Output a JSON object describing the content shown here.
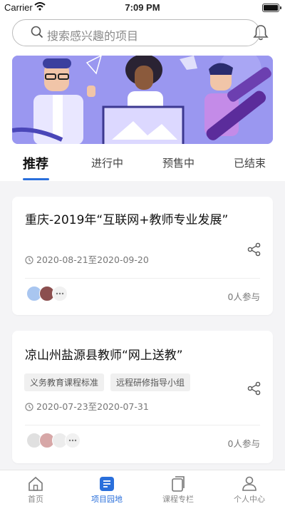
{
  "status_bar": {
    "carrier": "Carrier",
    "time": "7:09 PM"
  },
  "search": {
    "placeholder": "搜索感兴趣的项目"
  },
  "tabs": [
    {
      "label": "推荐",
      "active": true
    },
    {
      "label": "进行中",
      "active": false
    },
    {
      "label": "预售中",
      "active": false
    },
    {
      "label": "已结束",
      "active": false
    }
  ],
  "projects": [
    {
      "title": "重庆-2019年“互联网+教师专业发展”",
      "tags": [],
      "date_range": "2020-08-21至2020-09-20",
      "participants": "0人参与"
    },
    {
      "title": "凉山州盐源县教师“网上送教”",
      "tags": [
        "义务教育课程标准",
        "远程研修指导小组"
      ],
      "date_range": "2020-07-23至2020-07-31",
      "participants": "0人参与"
    }
  ],
  "bottom_nav": [
    {
      "label": "首页",
      "icon": "home-icon",
      "active": false
    },
    {
      "label": "项目园地",
      "icon": "project-icon",
      "active": true
    },
    {
      "label": "课程专栏",
      "icon": "course-icon",
      "active": false
    },
    {
      "label": "个人中心",
      "icon": "profile-icon",
      "active": false
    }
  ],
  "colors": {
    "accent": "#2a6fdb",
    "banner": "#9a97f0"
  }
}
